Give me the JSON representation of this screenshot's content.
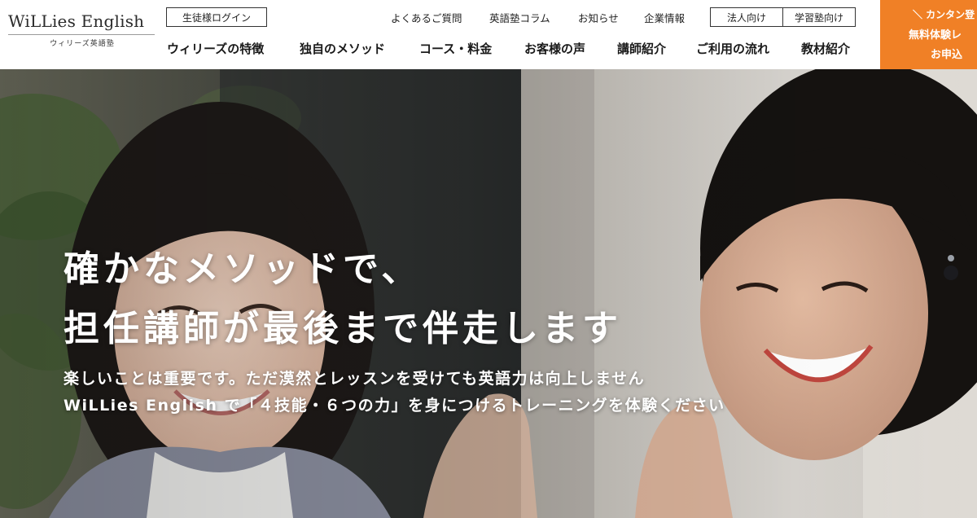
{
  "header": {
    "logo": {
      "name": "WiLLies English",
      "sub": "ウィリーズ英語塾"
    },
    "login_label": "生徒様ログイン",
    "util_links": [
      "よくあるご質問",
      "英語塾コラム",
      "お知らせ",
      "企業情報"
    ],
    "biz_buttons": [
      "法人向け",
      "学習塾向け"
    ],
    "main_nav": [
      "ウィリーズの特徴",
      "独自のメソッド",
      "コース・料金",
      "お客様の声",
      "講師紹介",
      "ご利用の流れ",
      "教材紹介"
    ],
    "cta": {
      "line1": "＼ カンタン登",
      "line2": "無料体験レ",
      "line3": "お申込",
      "color": "#f08026"
    }
  },
  "hero": {
    "title_line1": "確かなメソッドで、",
    "title_line2": "担任講師が最後まで伴走します",
    "sub_line1": "楽しいことは重要です。ただ漠然とレッスンを受けても英語力は向上しません",
    "sub_line2": "WiLLies English で「４技能・６つの力」を身につけるトレーニングを体験ください"
  }
}
